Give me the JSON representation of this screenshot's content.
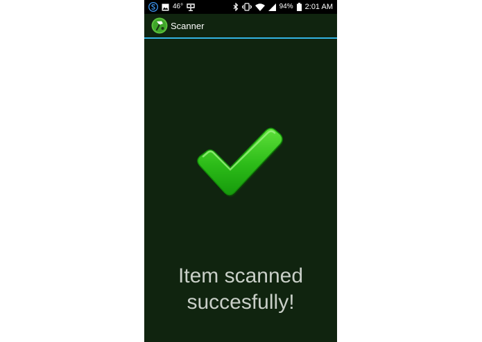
{
  "status_bar": {
    "temperature": "46°",
    "battery": "94%",
    "time": "2:01 AM"
  },
  "action_bar": {
    "title": "Scanner"
  },
  "main": {
    "message": "Item scanned\nsuccesfully!"
  },
  "colors": {
    "background": "#10240f",
    "accent_line": "#33b5e5",
    "check_green": "#2dbb1a",
    "text": "#c9cfc8"
  }
}
